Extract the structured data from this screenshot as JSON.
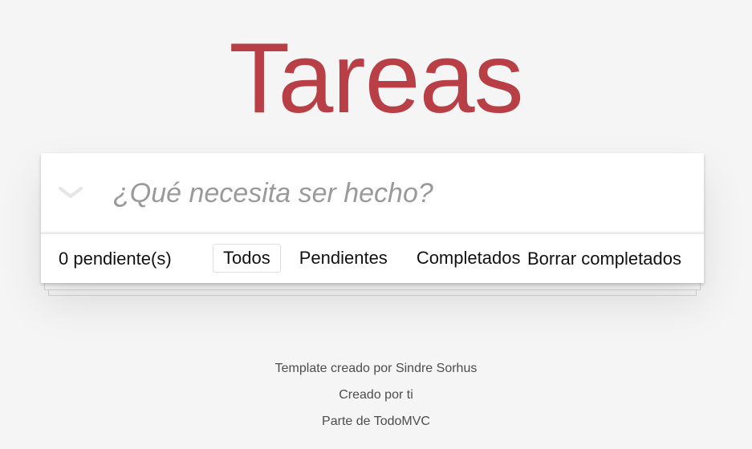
{
  "app": {
    "title": "Tareas"
  },
  "new_todo": {
    "placeholder": "¿Qué necesita ser hecho?",
    "value": "",
    "toggle_icon": "chevron-down-icon"
  },
  "footer": {
    "count_text": "0 pendiente(s)",
    "filters": [
      {
        "label": "Todos",
        "selected": true
      },
      {
        "label": "Pendientes",
        "selected": false
      },
      {
        "label": "Completados",
        "selected": false
      }
    ],
    "clear_label": "Borrar completados"
  },
  "info": {
    "line1": "Template creado por Sindre Sorhus",
    "line2": "Creado por ti",
    "line3": "Parte de TodoMVC"
  },
  "colors": {
    "title": "#b83f45",
    "background": "#f5f5f5"
  }
}
